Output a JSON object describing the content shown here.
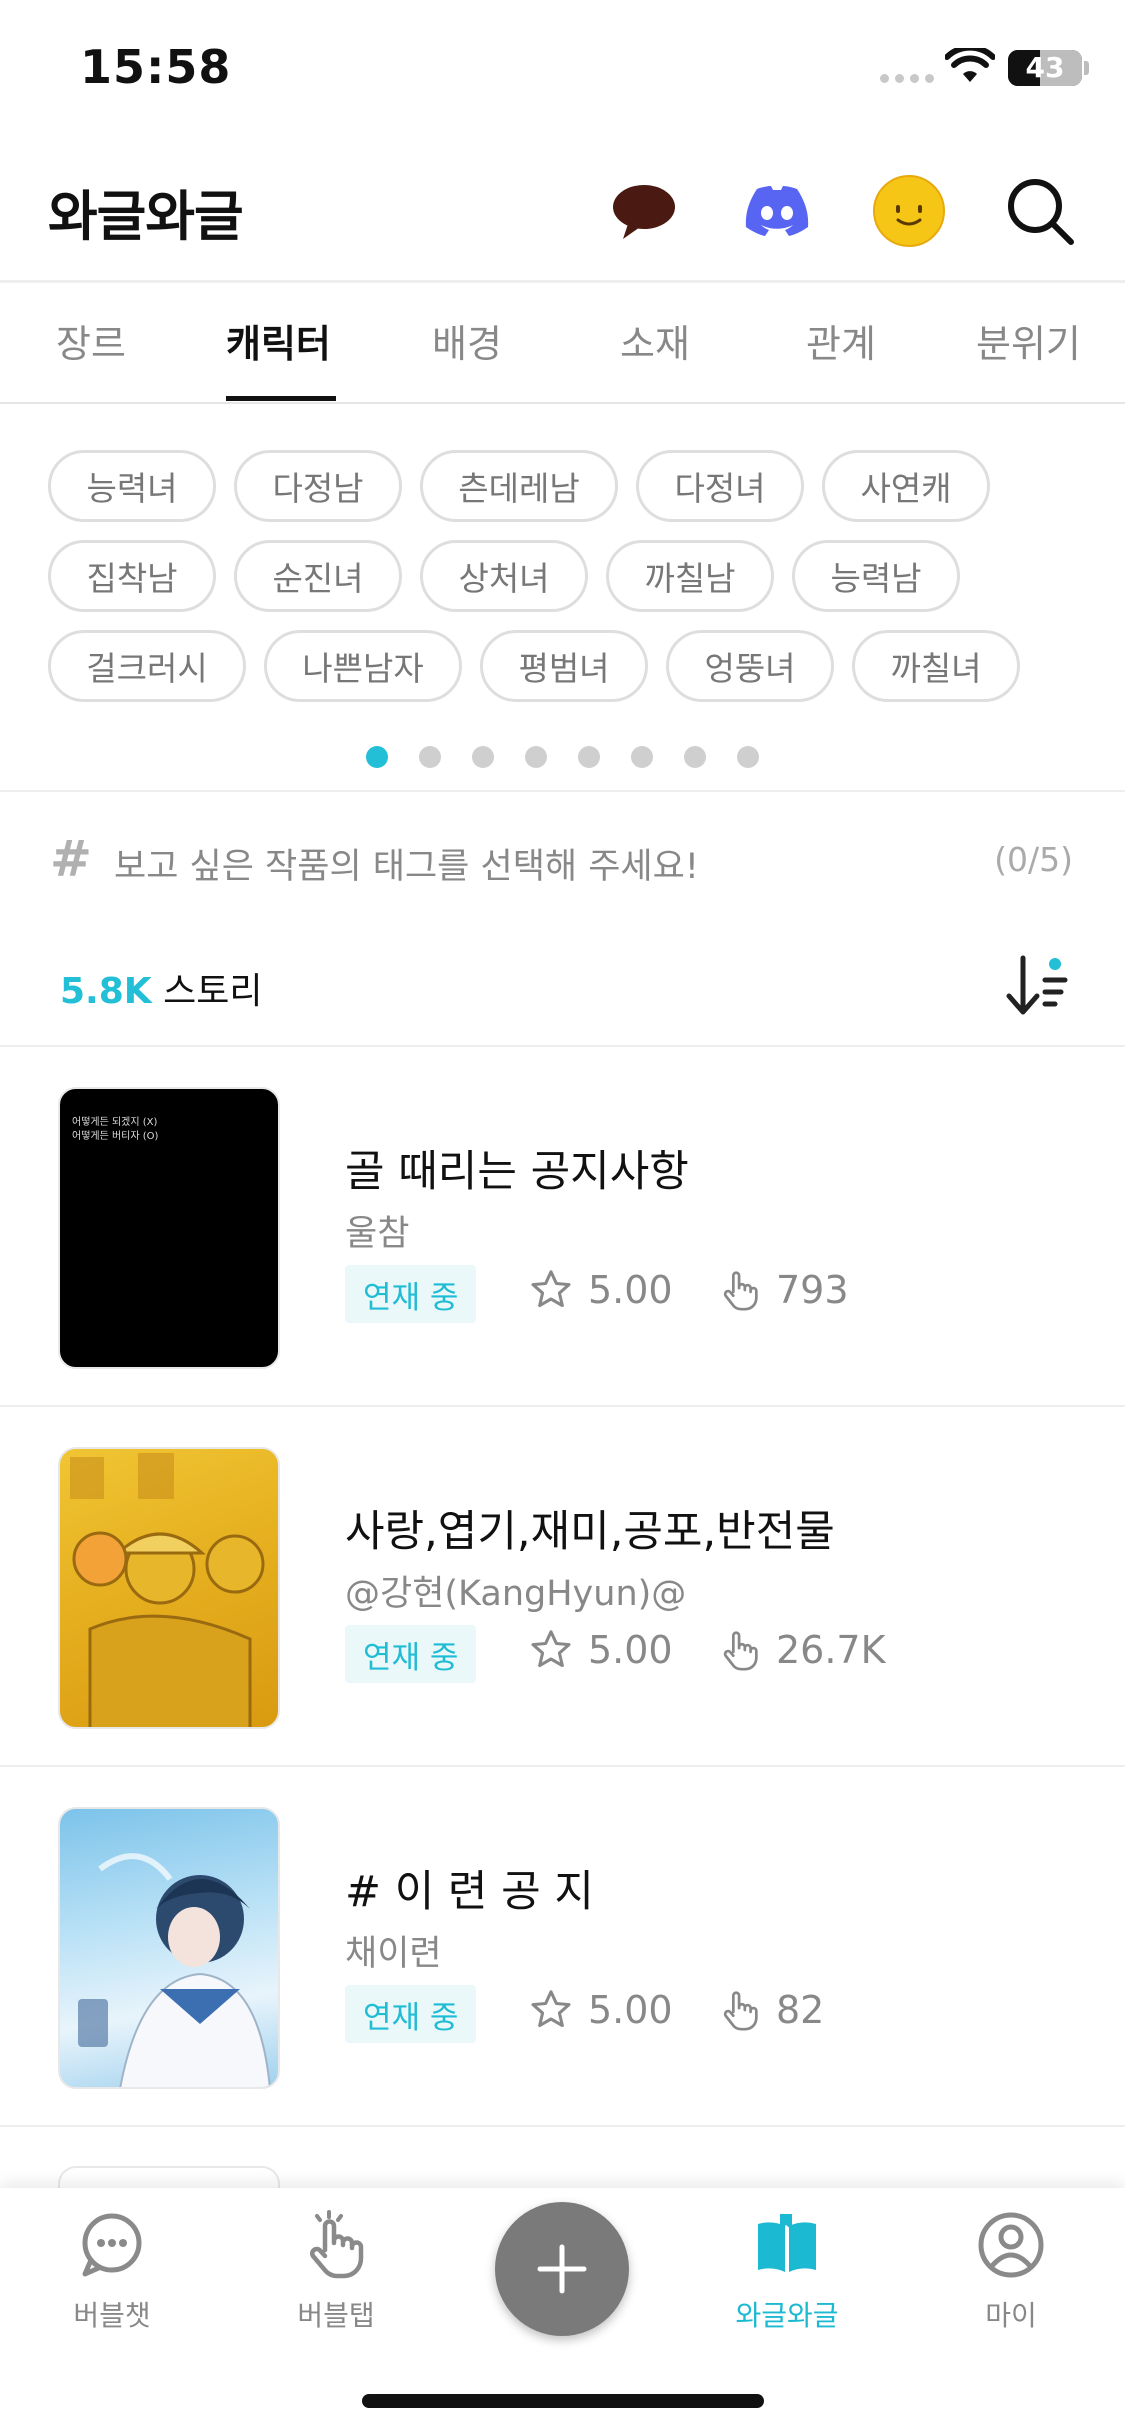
{
  "status_bar": {
    "time": "15:58",
    "battery": "43",
    "battery_level": 0.43
  },
  "header": {
    "title": "와글와글",
    "icons": [
      "speech-bubble-icon",
      "discord-icon",
      "smiley-face-icon",
      "search-icon"
    ]
  },
  "tabs": [
    {
      "label": "장르",
      "active": false
    },
    {
      "label": "캐릭터",
      "active": true
    },
    {
      "label": "배경",
      "active": false
    },
    {
      "label": "소재",
      "active": false
    },
    {
      "label": "관계",
      "active": false
    },
    {
      "label": "분위기",
      "active": false
    }
  ],
  "tags": [
    [
      "능력녀",
      "다정남",
      "츤데레남",
      "다정녀",
      "사연캐"
    ],
    [
      "집착남",
      "순진녀",
      "상처녀",
      "까칠남",
      "능력남"
    ],
    [
      "걸크러시",
      "나쁜남자",
      "평범녀",
      "엉뚱녀",
      "까칠녀"
    ]
  ],
  "pager": {
    "pages": 8,
    "current": 1
  },
  "tag_prompt": {
    "text": "보고 싶은 작품의 태그를 선택해 주세요!",
    "count": "(0/5)"
  },
  "story_count": {
    "number": "5.8K",
    "label": "스토리"
  },
  "stories": [
    {
      "title": "골 때리는 공지사항",
      "author": "울참",
      "status": "연재 중",
      "rating": "5.00",
      "taps": "793",
      "thumb_lines": [
        "어떻게든 되겠지 (X)",
        "어떻게든 버티자 (O)"
      ]
    },
    {
      "title": "사랑,엽기,재미,공포,반전물",
      "author": "@강현(KangHyun)@",
      "status": "연재 중",
      "rating": "5.00",
      "taps": "26.7K",
      "thumb_lines": []
    },
    {
      "title": "# 이 련 공 지",
      "author": "채이련",
      "status": "연재 중",
      "rating": "5.00",
      "taps": "82",
      "thumb_lines": []
    }
  ],
  "bottom_nav": [
    {
      "label": "버블챗",
      "icon": "chat-bubble-icon",
      "active": false
    },
    {
      "label": "버블탭",
      "icon": "tap-hand-icon",
      "active": false
    },
    {
      "label": "와글와글",
      "icon": "open-book-icon",
      "active": true
    },
    {
      "label": "마이",
      "icon": "profile-icon",
      "active": false
    }
  ],
  "fab": {
    "icon": "plus-icon"
  },
  "colors": {
    "accent": "#22bfd6",
    "badge_bg": "#eaf8fa",
    "fab": "#7a7a7a"
  }
}
